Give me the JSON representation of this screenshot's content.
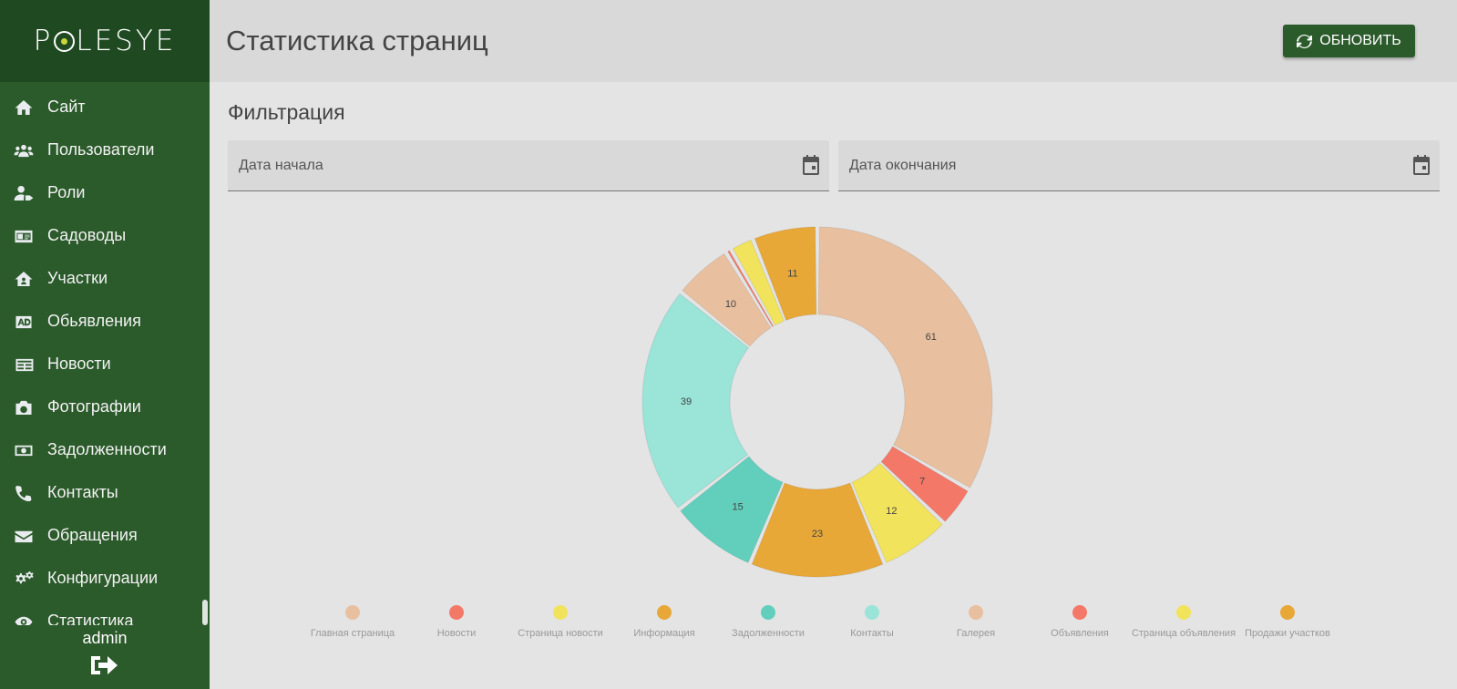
{
  "brand": {
    "logo_left": "P",
    "logo_right": "LESYE"
  },
  "sidebar": {
    "items": [
      {
        "label": "Сайт",
        "icon": "home-icon"
      },
      {
        "label": "Пользователи",
        "icon": "users-icon"
      },
      {
        "label": "Роли",
        "icon": "user-tag-icon"
      },
      {
        "label": "Садоводы",
        "icon": "id-card-icon"
      },
      {
        "label": "Участки",
        "icon": "house-user-icon"
      },
      {
        "label": "Обьявления",
        "icon": "ad-icon"
      },
      {
        "label": "Новости",
        "icon": "newspaper-icon"
      },
      {
        "label": "Фотографии",
        "icon": "camera-icon"
      },
      {
        "label": "Задолженности",
        "icon": "money-bill-icon"
      },
      {
        "label": "Контакты",
        "icon": "phone-icon"
      },
      {
        "label": "Обращения",
        "icon": "envelope-icon"
      },
      {
        "label": "Конфигурации",
        "icon": "cogs-icon"
      },
      {
        "label": "Статистика",
        "icon": "eye-icon"
      }
    ],
    "user": "admin"
  },
  "header": {
    "title": "Статистика страниц",
    "refresh_label": "ОБНОВИТЬ"
  },
  "filter": {
    "title": "Фильтрация",
    "start_placeholder": "Дата начала",
    "end_placeholder": "Дата окончания"
  },
  "chart_data": {
    "type": "pie",
    "donut": true,
    "legend_position": "bottom",
    "labels": [
      "Главная страница",
      "Новости",
      "Страница новости",
      "Информация",
      "Задолженности",
      "Контакты",
      "Галерея",
      "Объявления",
      "Страница объявления",
      "Продажи участков"
    ],
    "values": [
      61,
      7,
      12,
      23,
      15,
      39,
      10,
      1,
      4,
      11
    ],
    "colors": [
      "#e8c0a0",
      "#f47868",
      "#f2e35c",
      "#e8a838",
      "#62cfbd",
      "#9ae4d8",
      "#e8c0a0",
      "#f47868",
      "#f2e35c",
      "#e8a838"
    ],
    "show_value_min": 5
  }
}
